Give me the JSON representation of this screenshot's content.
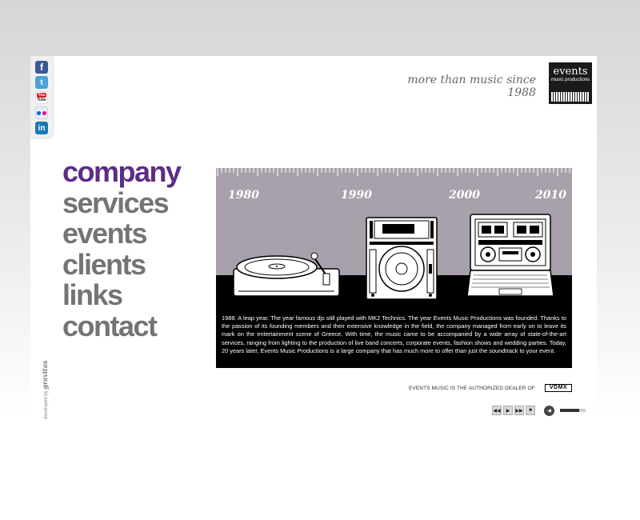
{
  "header": {
    "tagline": "more than music since 1988",
    "logo": {
      "main": "events",
      "sub": "music productions"
    }
  },
  "social": [
    {
      "name": "facebook-icon",
      "glyph": "f"
    },
    {
      "name": "twitter-icon",
      "glyph": "t"
    },
    {
      "name": "youtube-icon",
      "glyph": "YouTube"
    },
    {
      "name": "flickr-icon",
      "glyph": ""
    },
    {
      "name": "linkedin-icon",
      "glyph": "in"
    }
  ],
  "nav": {
    "items": [
      "company",
      "services",
      "events",
      "clients",
      "links",
      "contact"
    ],
    "active": "company"
  },
  "timeline": {
    "years": [
      "1980",
      "1990",
      "2000",
      "2010"
    ]
  },
  "description": "1988. A leap year. The year famous djs still played with MK2 Technics. The year Events Music Productions was founded. Thanks to the passion of its founding members and their extensive knowledge in the field, the company managed from early on to leave its mark on the entertainment scene of Greece. With time, the music came to be accompanied by a wide array of state-of-the-art services, ranging from lighting to the production of live band concerts, corporate events, fashion shows and wedding parties. Today, 20 years later, Events Music Productions is a large company that has much more to offer than just the soundtrack to your event.",
  "dealer": {
    "text": "EVENTS MUSIC IS THE AUTHORIZED DEALER OF",
    "brand": "VDMX"
  },
  "player": {
    "buttons": [
      "prev-button",
      "play-button",
      "next-button",
      "stop-button"
    ],
    "volume": 0.75
  },
  "credit": {
    "prefix": "developed by",
    "brand": "gravitas"
  }
}
